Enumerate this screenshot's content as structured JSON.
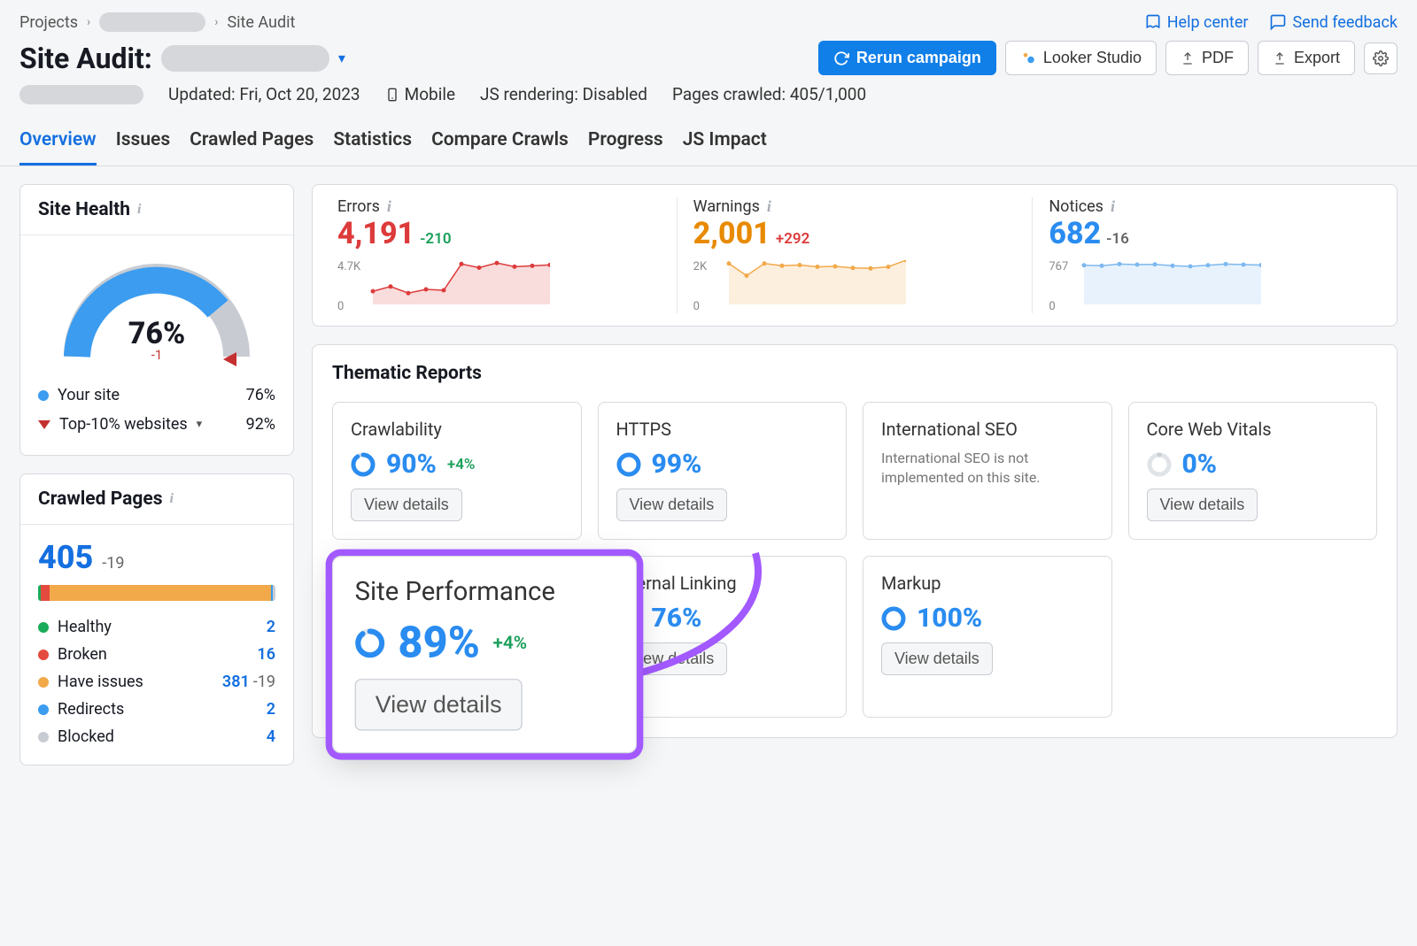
{
  "breadcrumb": {
    "root": "Projects",
    "current": "Site Audit"
  },
  "page_title_prefix": "Site Audit:",
  "top_links": {
    "help": "Help center",
    "feedback": "Send feedback"
  },
  "actions": {
    "rerun": "Rerun campaign",
    "looker": "Looker Studio",
    "pdf": "PDF",
    "export": "Export"
  },
  "meta": {
    "updated": "Updated: Fri, Oct 20, 2023",
    "device": "Mobile",
    "js_rendering": "JS rendering: Disabled",
    "pages_crawled": "Pages crawled: 405/1,000"
  },
  "tabs": [
    "Overview",
    "Issues",
    "Crawled Pages",
    "Statistics",
    "Compare Crawls",
    "Progress",
    "JS Impact"
  ],
  "active_tab": "Overview",
  "site_health": {
    "title": "Site Health",
    "value": "76%",
    "delta": "-1",
    "legend": {
      "your_site_label": "Your site",
      "your_site_value": "76%",
      "top10_label": "Top-10% websites",
      "top10_value": "92%"
    }
  },
  "crawled_pages": {
    "title": "Crawled Pages",
    "count": "405",
    "delta": "-19",
    "breakdown": [
      {
        "label": "Healthy",
        "count": "2",
        "color": "#1aab5a"
      },
      {
        "label": "Broken",
        "count": "16",
        "color": "#e44a3d"
      },
      {
        "label": "Have issues",
        "count": "381",
        "delta": "-19",
        "color": "#f2a94a"
      },
      {
        "label": "Redirects",
        "count": "2",
        "color": "#3b9cf0"
      },
      {
        "label": "Blocked",
        "count": "4",
        "color": "#c8ccd2"
      }
    ]
  },
  "stats": {
    "errors": {
      "label": "Errors",
      "value": "4,191",
      "delta": "-210",
      "delta_class": "green",
      "ymax": "4.7K",
      "ymin": "0"
    },
    "warnings": {
      "label": "Warnings",
      "value": "2,001",
      "delta": "+292",
      "delta_class": "red",
      "ymax": "2K",
      "ymin": "0"
    },
    "notices": {
      "label": "Notices",
      "value": "682",
      "delta": "-16",
      "delta_class": "grey",
      "ymax": "767",
      "ymin": "0"
    }
  },
  "chart_data": [
    {
      "type": "line",
      "title": "Errors",
      "ylim": [
        0,
        4700
      ],
      "x": [
        1,
        2,
        3,
        4,
        5,
        6,
        7,
        8,
        9,
        10,
        11
      ],
      "values": [
        1400,
        1900,
        1200,
        1600,
        1500,
        4300,
        3900,
        4400,
        4000,
        4100,
        4191
      ],
      "color": "#dd3b3b",
      "fill": true
    },
    {
      "type": "line",
      "title": "Warnings",
      "ylim": [
        0,
        2000
      ],
      "x": [
        1,
        2,
        3,
        4,
        5,
        6,
        7,
        8,
        9,
        10,
        11
      ],
      "values": [
        1850,
        1300,
        1850,
        1750,
        1780,
        1700,
        1720,
        1650,
        1630,
        1700,
        2001
      ],
      "color": "#f2a94a",
      "fill": true
    },
    {
      "type": "line",
      "title": "Notices",
      "ylim": [
        0,
        767
      ],
      "x": [
        1,
        2,
        3,
        4,
        5,
        6,
        7,
        8,
        9,
        10,
        11
      ],
      "values": [
        680,
        670,
        700,
        690,
        695,
        670,
        660,
        680,
        700,
        690,
        682
      ],
      "color": "#7db8ef",
      "fill": true
    }
  ],
  "thematic": {
    "title": "Thematic Reports",
    "view_details": "View details",
    "reports": [
      {
        "title": "Crawlability",
        "pct": "90%",
        "delta": "+4%",
        "ring": 0.9
      },
      {
        "title": "HTTPS",
        "pct": "99%",
        "ring": 0.99
      },
      {
        "title": "International SEO",
        "note": "International SEO is not implemented on this site."
      },
      {
        "title": "Core Web Vitals",
        "pct": "0%",
        "ring": 0.0,
        "grey_ring": true
      },
      {
        "title": "Site Performance",
        "pct": "89%",
        "delta": "+4%",
        "ring": 0.89,
        "highlight": true
      },
      {
        "title": "Internal Linking",
        "pct": "76%",
        "ring": 0.76
      },
      {
        "title": "Markup",
        "pct": "100%",
        "ring": 1.0
      }
    ]
  }
}
